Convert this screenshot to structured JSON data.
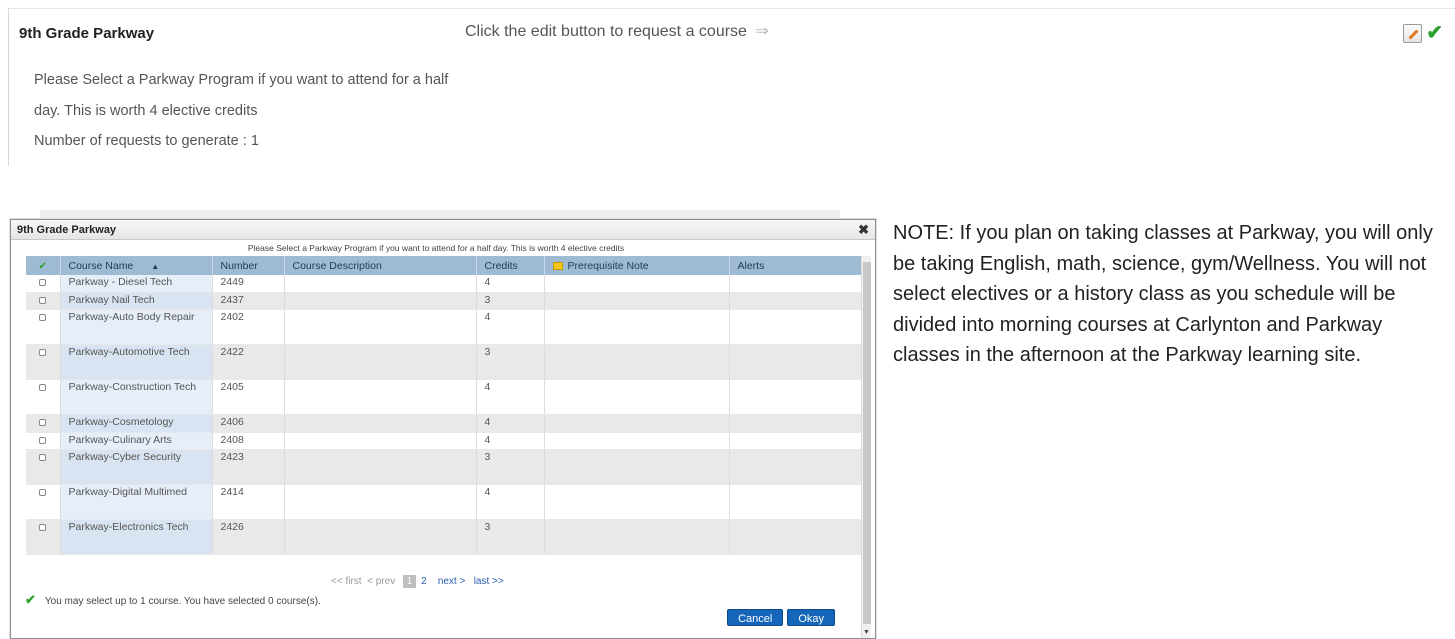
{
  "panel": {
    "title": "9th Grade Parkway",
    "hint": "Click the edit button to request a course",
    "hint_arrow": "⇒",
    "description": "Please Select a Parkway Program if you want to attend for a half day. This is worth 4 elective credits",
    "request_count_label": "Number of requests to generate : 1"
  },
  "dialog": {
    "title": "9th Grade Parkway",
    "close": "✖",
    "subtitle": "Please Select a Parkway Program if you want to attend for a half day. This is worth 4 elective credits",
    "columns": {
      "check": "✔",
      "course_name": "Course Name",
      "sort": "▲",
      "number": "Number",
      "description": "Course Description",
      "credits": "Credits",
      "prereq": "Prerequisite Note",
      "alerts": "Alerts"
    },
    "rows": [
      {
        "name": "Parkway - Diesel Tech",
        "number": "2449",
        "description": "",
        "credits": "4",
        "prereq": "",
        "alerts": ""
      },
      {
        "name": "Parkway Nail Tech",
        "number": "2437",
        "description": "",
        "credits": "3",
        "prereq": "",
        "alerts": ""
      },
      {
        "name": "Parkway-Auto Body Repair",
        "number": "2402",
        "description": "",
        "credits": "4",
        "prereq": "",
        "alerts": ""
      },
      {
        "name": "Parkway-Automotive Tech",
        "number": "2422",
        "description": "",
        "credits": "3",
        "prereq": "",
        "alerts": ""
      },
      {
        "name": "Parkway-Construction Tech",
        "number": "2405",
        "description": "",
        "credits": "4",
        "prereq": "",
        "alerts": ""
      },
      {
        "name": "Parkway-Cosmetology",
        "number": "2406",
        "description": "",
        "credits": "4",
        "prereq": "",
        "alerts": ""
      },
      {
        "name": "Parkway-Culinary Arts",
        "number": "2408",
        "description": "",
        "credits": "4",
        "prereq": "",
        "alerts": ""
      },
      {
        "name": "Parkway-Cyber Security",
        "number": "2423",
        "description": "",
        "credits": "3",
        "prereq": "",
        "alerts": ""
      },
      {
        "name": "Parkway-Digital Multimed",
        "number": "2414",
        "description": "",
        "credits": "4",
        "prereq": "",
        "alerts": ""
      },
      {
        "name": "Parkway-Electronics Tech",
        "number": "2426",
        "description": "",
        "credits": "3",
        "prereq": "",
        "alerts": ""
      }
    ],
    "pager": {
      "first": "<< first",
      "prev": "< prev",
      "current": "1",
      "page2": "2",
      "next": "next >",
      "last": "last >>"
    },
    "selection_message": "You may select up to 1 course.  You have selected 0 course(s).",
    "cancel_label": "Cancel",
    "okay_label": "Okay"
  },
  "note": "NOTE: If you plan on taking classes at Parkway, you will only be taking English, math, science, gym/Wellness. You will not select electives or a history class as you schedule will be divided into morning courses at Carlynton and Parkway classes in the afternoon at the Parkway learning site.",
  "colors": {
    "header_blue": "#9fbbd4",
    "button_blue": "#1565b8",
    "check_green": "#2ea02e"
  }
}
